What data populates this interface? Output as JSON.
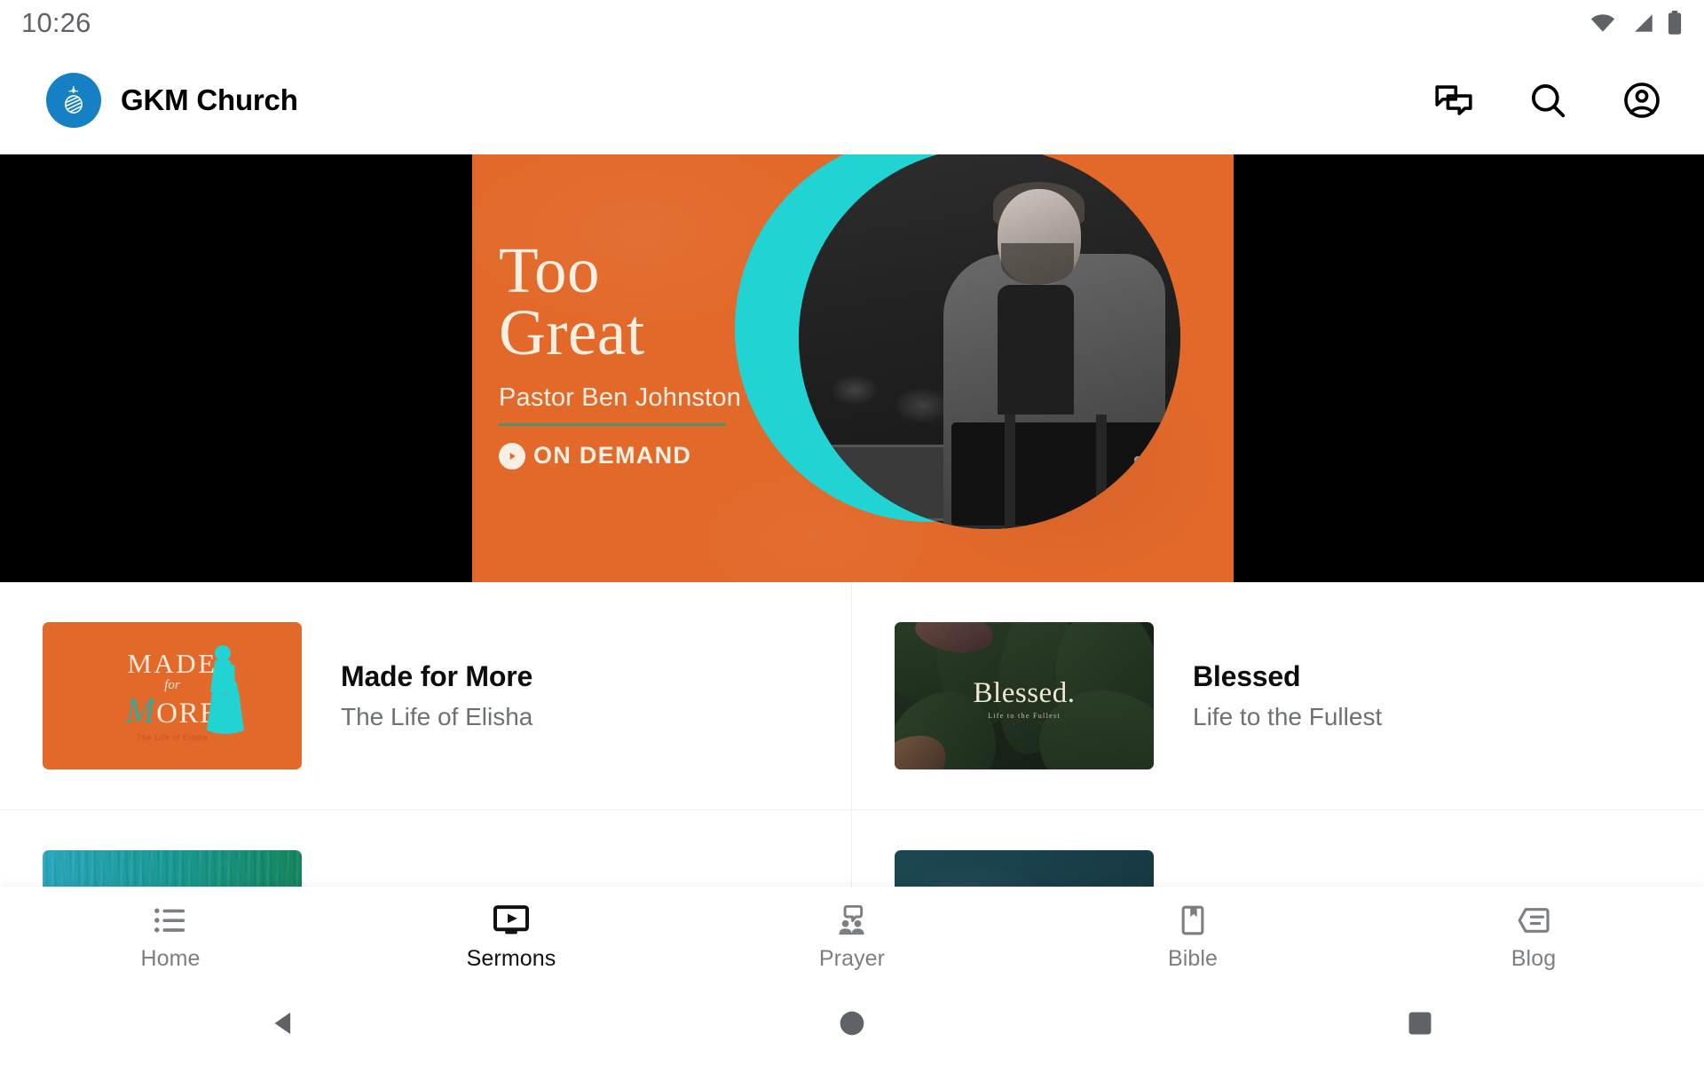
{
  "status_bar": {
    "time": "10:26",
    "icons": [
      "wifi-icon",
      "cellular-signal-icon",
      "battery-icon"
    ]
  },
  "app_bar": {
    "brand_name": "GKM Church",
    "logo_icon": "gkm-globe-logo-icon",
    "logo_color": "#1580c4",
    "actions": [
      {
        "name": "messages-icon",
        "label": "Messages"
      },
      {
        "name": "search-icon",
        "label": "Search"
      },
      {
        "name": "account-icon",
        "label": "Account"
      }
    ]
  },
  "hero": {
    "title_line1": "Too",
    "title_line2": "Great",
    "speaker": "Pastor Ben Johnston",
    "badge": "ON DEMAND",
    "badge_icon": "play-circle-icon",
    "bg_color": "#e2692a",
    "accent_color": "#22d3d3",
    "rule_color": "#4f8f6a",
    "text_color": "#f7efe2"
  },
  "series_list": [
    {
      "title": "Made for More",
      "subtitle": "The Life of Elisha",
      "thumb_name": "thumbnail-made-for-more",
      "thumb_kind": "made-for-more",
      "thumb_color": "#e2692a",
      "art_primary": "MADE",
      "art_connector": "for",
      "art_secondary": "ORE",
      "art_script": "M",
      "art_tagline": "The Life of Elisha"
    },
    {
      "title": "Blessed",
      "subtitle": "Life to the Fullest",
      "thumb_name": "thumbnail-blessed",
      "thumb_kind": "blessed",
      "thumb_color": "#1a251a",
      "art_primary": "Blessed.",
      "art_tagline": "Life to the Fullest"
    },
    {
      "title": "",
      "subtitle": "",
      "thumb_name": "thumbnail-series-three",
      "thumb_kind": "teal",
      "thumb_color": "#199a96"
    },
    {
      "title": "",
      "subtitle": "",
      "thumb_name": "thumbnail-series-four",
      "thumb_kind": "navy",
      "thumb_color": "#1a3f4a"
    }
  ],
  "bottom_nav": {
    "active_index": 1,
    "items": [
      {
        "label": "Home",
        "icon": "list-icon",
        "active": false
      },
      {
        "label": "Sermons",
        "icon": "tv-play-icon",
        "active": true
      },
      {
        "label": "Prayer",
        "icon": "people-speech-icon",
        "active": false
      },
      {
        "label": "Bible",
        "icon": "book-bookmark-icon",
        "active": false
      },
      {
        "label": "Blog",
        "icon": "article-icon",
        "active": false
      }
    ]
  },
  "system_nav": {
    "buttons": [
      {
        "name": "back-button",
        "icon": "triangle-back-icon"
      },
      {
        "name": "home-button",
        "icon": "circle-home-icon"
      },
      {
        "name": "recents-button",
        "icon": "square-recents-icon"
      }
    ]
  }
}
